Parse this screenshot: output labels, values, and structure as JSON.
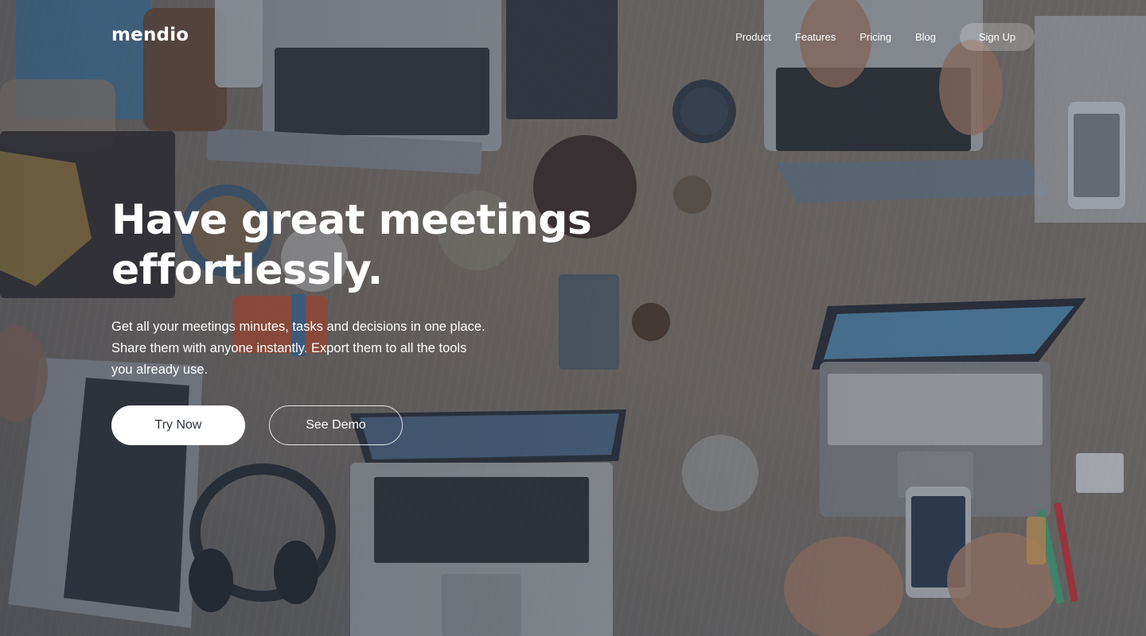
{
  "brand": {
    "name": "mendio"
  },
  "nav": {
    "links": [
      "Product",
      "Features",
      "Pricing",
      "Blog"
    ],
    "signup_label": "Sign Up"
  },
  "hero": {
    "headline_line1": "Have great meetings",
    "headline_line2": "effortlessly.",
    "subtext": "Get all your meetings minutes, tasks and decisions in one place. Share them with anyone instantly. Export them to all the tools you already use.",
    "primary_cta": "Try Now",
    "secondary_cta": "See Demo"
  },
  "colors": {
    "overlay": "#2c3442",
    "text": "#ffffff",
    "primary_button_bg": "#ffffff",
    "primary_button_text": "#2e3340"
  }
}
